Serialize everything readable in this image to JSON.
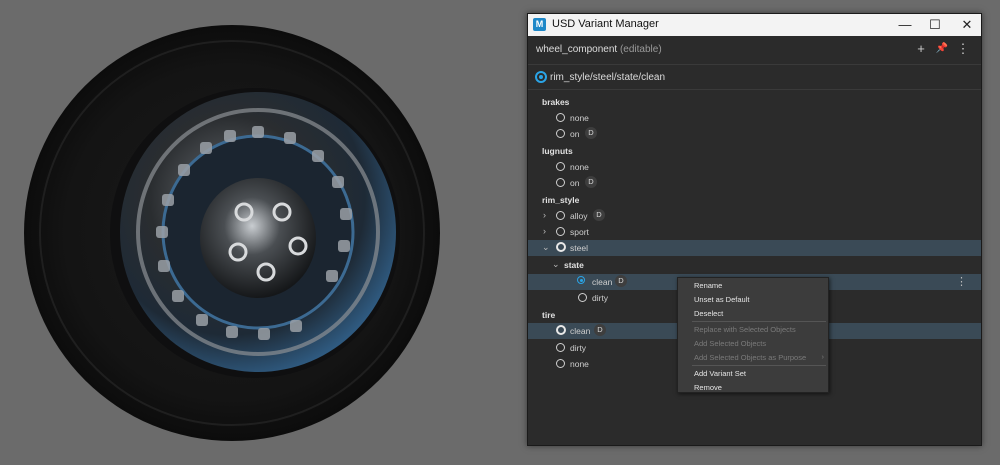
{
  "window": {
    "icon_label": "M",
    "title": "USD Variant Manager",
    "controls": {
      "minimize": "—",
      "maximize": "☐",
      "close": "✕"
    }
  },
  "header": {
    "component": "wheel_component",
    "editable": "(editable)",
    "add_icon": "+",
    "pin_icon": "📌",
    "more_icon": "⋮"
  },
  "path": {
    "text": "rim_style/steel/state/clean"
  },
  "tree": {
    "brakes": {
      "label": "brakes",
      "none": "none",
      "on": "on",
      "on_badge": "D"
    },
    "lugnuts": {
      "label": "lugnuts",
      "none": "none",
      "on": "on",
      "on_badge": "D"
    },
    "rim_style": {
      "label": "rim_style",
      "alloy": "alloy",
      "alloy_badge": "D",
      "sport": "sport",
      "steel": "steel",
      "state": {
        "label": "state",
        "clean": "clean",
        "clean_badge": "D",
        "dirty": "dirty"
      }
    },
    "tire": {
      "label": "tire",
      "clean": "clean",
      "clean_badge": "D",
      "dirty": "dirty",
      "none": "none"
    }
  },
  "context_menu": {
    "rename": "Rename",
    "unset_default": "Unset as Default",
    "deselect": "Deselect",
    "replace_selected": "Replace with Selected Objects",
    "add_selected": "Add Selected Objects",
    "add_selected_purpose": "Add Selected Objects as Purpose",
    "add_variant_set": "Add Variant Set",
    "remove": "Remove",
    "submenu_arrow": "›"
  },
  "colors": {
    "accent": "#2aa4e6",
    "highlight": "#3a4a56",
    "panel": "#2b2b2b"
  }
}
